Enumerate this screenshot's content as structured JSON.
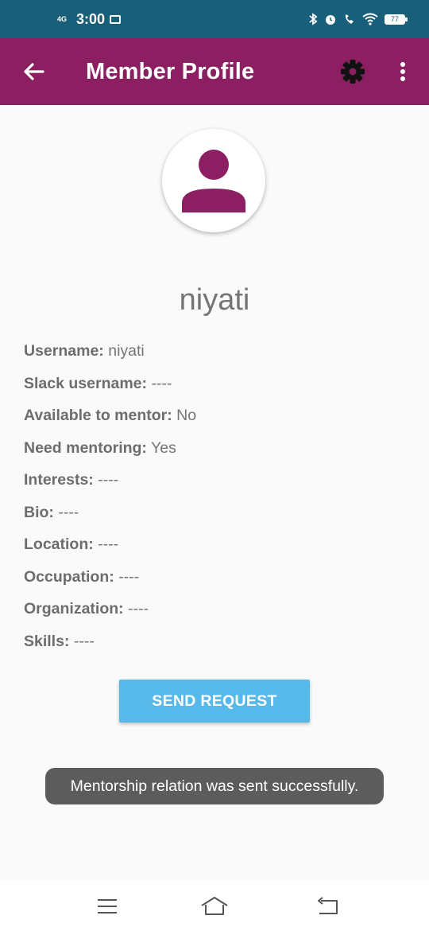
{
  "status_bar": {
    "network": "4G",
    "time": "3:00",
    "battery": "77"
  },
  "app_bar": {
    "title": "Member Profile"
  },
  "profile": {
    "name": "niyati",
    "fields": [
      {
        "label": "Username:",
        "value": "niyati"
      },
      {
        "label": "Slack username:",
        "value": "----"
      },
      {
        "label": "Available to mentor:",
        "value": "No"
      },
      {
        "label": "Need mentoring:",
        "value": "Yes"
      },
      {
        "label": "Interests:",
        "value": "----"
      },
      {
        "label": "Bio:",
        "value": "----"
      },
      {
        "label": "Location:",
        "value": "----"
      },
      {
        "label": "Occupation:",
        "value": "----"
      },
      {
        "label": "Organization:",
        "value": "----"
      },
      {
        "label": "Skills:",
        "value": "----"
      }
    ]
  },
  "actions": {
    "send_request": "SEND REQUEST"
  },
  "toast": {
    "message": "Mentorship relation was sent successfully."
  },
  "colors": {
    "app_bar": "#8b1f61",
    "status_bar": "#1a5f7a",
    "button": "#56b9e9",
    "avatar_icon": "#8b1f61"
  },
  "icons": {
    "back": "arrow-left-icon",
    "settings": "gear-icon",
    "more": "more-vertical-icon",
    "avatar": "person-icon",
    "nav_menu": "menu-icon",
    "nav_home": "home-icon",
    "nav_back": "back-icon"
  }
}
